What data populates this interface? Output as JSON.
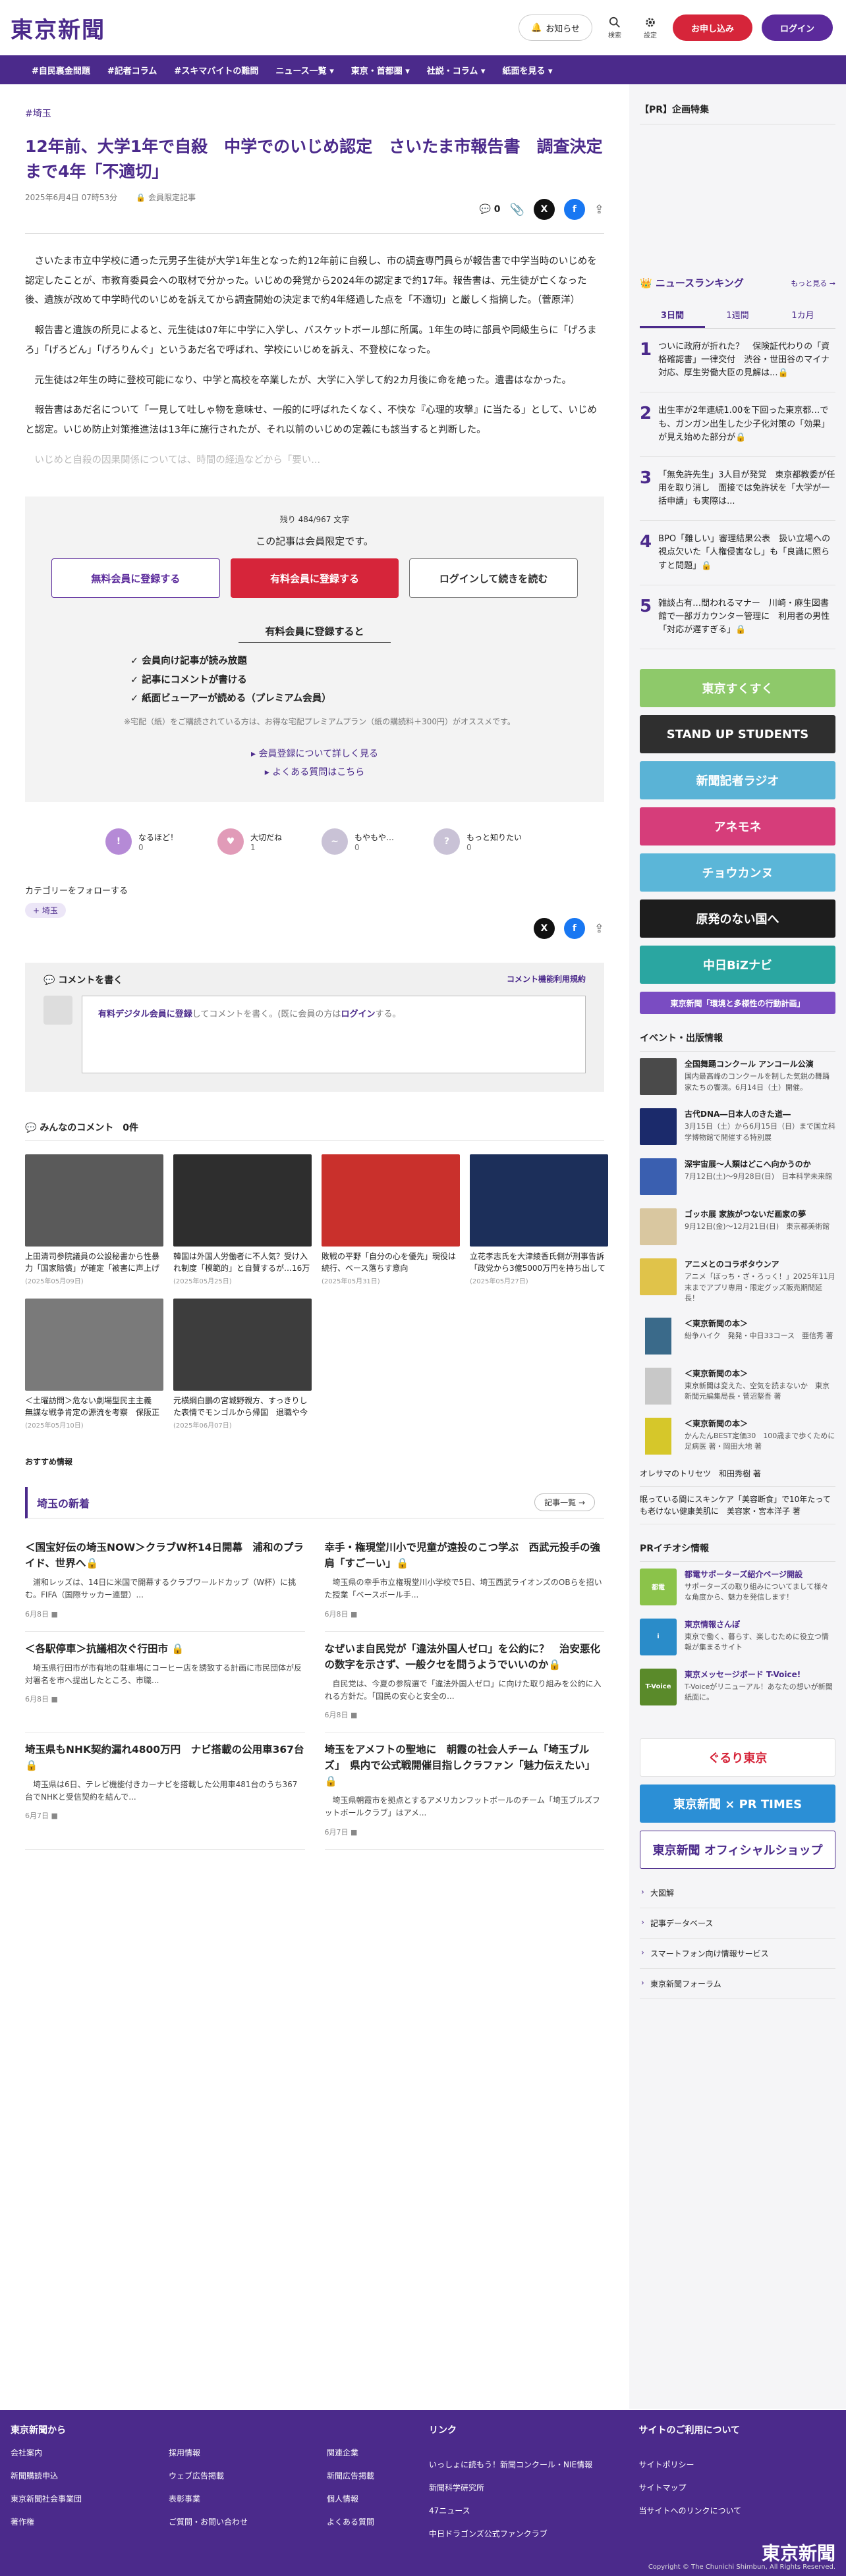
{
  "header": {
    "logo": "東京新聞",
    "notify": "お知らせ",
    "search": "検索",
    "settings": "設定",
    "subscribe": "お申し込み",
    "login": "ログイン"
  },
  "nav": [
    "#自民裏金問題",
    "#記者コラム",
    "#スキマバイトの難問",
    "ニュース一覧 ▾",
    "東京・首都圏 ▾",
    "社説・コラム ▾",
    "紙面を見る ▾"
  ],
  "article": {
    "tag": "#埼玉",
    "title": "12年前、大学1年で自殺　中学でのいじめ認定　さいたま市報告書　調査決定まで4年「不適切」",
    "date": "2025年6月4日 07時53分",
    "member_only": "会員限定記事",
    "comment_count": "0",
    "paragraphs": [
      "　さいたま市立中学校に通った元男子生徒が大学1年生となった約12年前に自殺し、市の調査専門員らが報告書で中学当時のいじめを認定したことが、市教育委員会への取材で分かった。いじめの発覚から2024年の認定まで約17年。報告書は、元生徒が亡くなった後、遺族が改めて中学時代のいじめを訴えてから調査開始の決定まで約4年経過した点を「不適切」と厳しく指摘した。（菅原洋）",
      "　報告書と遺族の所見によると、元生徒は07年に中学に入学し、バスケットボール部に所属。1年生の時に部員や同級生らに「げろまろ」「げろどん」「げろりんぐ」というあだ名で呼ばれ、学校にいじめを訴え、不登校になった。",
      "　元生徒は2年生の時に登校可能になり、中学と高校を卒業したが、大学に入学して約2カ月後に命を絶った。遺書はなかった。",
      "　報告書はあだ名について「一見して吐しゃ物を意味せ、一般的に呼ばれたくなく、不快な『心理的攻撃』に当たる」として、いじめと認定。いじめ防止対策推進法は13年に施行されたが、それ以前のいじめの定義にも該当すると判断した。"
    ],
    "fade_paragraph": "　いじめと自殺の因果関係については、時間の経過などから「要い...",
    "share": {
      "x": "X",
      "facebook": "f"
    }
  },
  "paywall": {
    "remaining": "残り 484/967 文字",
    "members_only": "この記事は会員限定です。",
    "free_btn": "無料会員に登録する",
    "paid_btn": "有料会員に登録する",
    "login_btn": "ログインして続きを読む",
    "benefit_title": "有料会員に登録すると",
    "benefits": [
      "✓ 会員向け記事が読み放題",
      "✓ 記事にコメントが書ける",
      "✓ 紙面ビューアーが読める（プレミアム会員）"
    ],
    "notice": "※宅配（紙）をご購読されている方は、お得な宅配プレミアムプラン（紙の購読料＋300円）がオススメです。",
    "link1": "▸ 会員登録について詳しく見る",
    "link2": "▸ よくある質問はこちら"
  },
  "reactions": [
    {
      "label": "なるほど！",
      "count": "0",
      "color": "#b58ad6",
      "glyph": "!"
    },
    {
      "label": "大切だね",
      "count": "1",
      "color": "#e19bb8",
      "glyph": "♥"
    },
    {
      "label": "もやもや…",
      "count": "0",
      "color": "#c9c2d6",
      "glyph": "~"
    },
    {
      "label": "もっと知りたい",
      "count": "0",
      "color": "#c9c2d6",
      "glyph": "?"
    }
  ],
  "follow": {
    "title": "カテゴリーをフォローする",
    "chip": "埼玉"
  },
  "comments": {
    "write": "コメントを書く",
    "policy": "コメント機能利用規約",
    "placeholder_a": "有料デジタル会員に登録",
    "placeholder_b": "してコメントを書く。(既に会員の方は",
    "placeholder_c": "ログイン",
    "placeholder_d": "する。",
    "all": "みんなのコメント　0件"
  },
  "thumbs": [
    {
      "title": "上田清司参院議員の公設秘書から性暴力「国家賠償」が確定「被害に声上げることため...",
      "date": "(2025年05月09日)",
      "color": "#5a5a5a"
    },
    {
      "title": "韓国は外国人労働者に不人気？受け入れ制度「模範的」と自賛するが…16万5000人の枠が半...",
      "date": "(2025年05月25日)",
      "color": "#2e2e2e"
    },
    {
      "title": "敗戦の平野「自分の心を優先」現役は続行、ベース落ちす意向",
      "date": "(2025年05月31日)",
      "color": "#c9302c"
    },
    {
      "title": "立花孝志氏を大津綾香氏側が刑事告訴「政党から3億5000万円を持ち出して一部を横領」警...",
      "date": "(2025年05月27日)",
      "color": "#1c2f5a"
    },
    {
      "title": "＜土曜訪問＞危ない劇場型民主主義　無謀な戦争肯定の源流を考察　保阪正康さん（ノンフィ...",
      "date": "(2025年05月10日)",
      "color": "#7a7a7a"
    },
    {
      "title": "元横綱白鵬の宮城野親方、すっきりした表情でモンゴルから帰国　退職や今後については言...",
      "date": "(2025年06月07日)",
      "color": "#3d3d3d"
    }
  ],
  "recommend": "おすすめ情報",
  "saitama": {
    "title": "埼玉の新着",
    "more": "記事一覧 →",
    "items": [
      {
        "title": "＜国宝好伝の埼玉NOW＞クラブW杯14日開幕　浦和のプライド、世界へ🔒",
        "body": "　浦和レッズは、14日に米国で開幕するクラブワールドカップ（W杯）に挑む。FIFA（国際サッカー連盟）...",
        "date": "6月8日 ■"
      },
      {
        "title": "幸手・権現堂川小で児童が遠投のこつ学ぶ　西武元投手の強肩「すごーい」🔒",
        "body": "　埼玉県の幸手市立権現堂川小学校で5日、埼玉西武ライオンズのOBらを招いた授業「ベースボール手...",
        "date": "6月8日 ■"
      },
      {
        "title": "＜各駅停車＞抗議相次ぐ行田市 🔒",
        "body": "　埼玉県行田市が市有地の駐車場にコーヒー店を誘致する計画に市民団体が反対署名を市へ提出したところ、市職...",
        "date": "6月8日 ■"
      },
      {
        "title": "なぜいま自民党が「違法外国人ゼロ」を公約に？　治安悪化の数字を示さず、一般クセを問うようでいいのか🔒",
        "body": "　自民党は、今夏の参院選で「違法外国人ゼロ」に向けた取り組みを公約に入れる方針だ。「国民の安心と安全の...",
        "date": "6月8日 ■"
      },
      {
        "title": "埼玉県もNHK契約漏れ4800万円　ナビ搭載の公用車367台 🔒",
        "body": "　埼玉県は6日、テレビ機能付きカーナビを搭載した公用車481台のうち367台でNHKと受信契約を結んで...",
        "date": "6月7日 ■"
      },
      {
        "title": "埼玉をアメフトの聖地に　朝霞の社会人チーム「埼玉ブルズ」　県内で公式戦開催目指しクラファン「魅力伝えたい」🔒",
        "body": "　埼玉県朝霞市を拠点とするアメリカンフットボールのチーム「埼玉ブルズフットボールクラブ」はアメ...",
        "date": "6月7日 ■"
      }
    ]
  },
  "sidebar": {
    "pr_title": "【PR】企画特集",
    "ranking_title": "ニュースランキング",
    "ranking_more": "もっと見る →",
    "tabs": [
      "3日間",
      "1週間",
      "1カ月"
    ],
    "ranking": [
      "ついに政府が折れた？　保険証代わりの「資格確認書」一律交付　渋谷・世田谷のマイナ対応、厚生労働大臣の見解は...🔒",
      "出生率が2年連続1.00を下回った東京都…でも、ガンガン出生した少子化対策の「効果」が見え始めた部分が🔒",
      "「無免許先生」3人目が発覚　東京都教委が任用を取り消し　面接では免許状を「大学が一括申請」も実際は...",
      "BPO「難しい」審理結果公表　扱い立場への視点欠いた「人権侵害なし」も「良識に照らすと問題」🔒",
      "雑談占有…間われるマナー　川崎・麻生図書館で一部ガカウンター管理に　利用者の男性「対応が遅すぎる」🔒"
    ],
    "banners": [
      {
        "text": "東京すくすく",
        "color": "#8ec96a"
      },
      {
        "text": "STAND UP STUDENTS",
        "color": "#2f2f2f"
      },
      {
        "text": "新聞記者ラジオ",
        "color": "#5ab3d6"
      },
      {
        "text": "アネモネ",
        "color": "#d63d7a"
      },
      {
        "text": "チョウカンヌ",
        "color": "#5bb6d8"
      },
      {
        "text": "原発のない国へ",
        "color": "#1d1d1d"
      },
      {
        "text": "中日BiZナビ",
        "color": "#2aa6a1"
      },
      {
        "text": "東京新聞「環境と多様性の行動計画」",
        "color": "#7a4cc2"
      }
    ],
    "events_title": "イベント・出版情報",
    "events": [
      {
        "title": "全国舞踊コンクール アンコール公演",
        "desc": "国内最高峰のコンクールを制した気鋭の舞踊家たちの饗演。6月14日（土）開催。",
        "color": "#4a4a4a"
      },
      {
        "title": "古代DNA―日本人のきた道―",
        "desc": "3月15日（土）から6月15日（日）まで国立科学博物館で開催する特別展",
        "color": "#1b2a6b"
      },
      {
        "title": "深宇宙展～人類はどこへ向かうのか",
        "desc": "7月12日(土)～9月28日(日)　日本科学未来館",
        "color": "#3a5fb0"
      },
      {
        "title": "ゴッホ展 家族がつないだ画家の夢",
        "desc": "9月12日(金)～12月21日(日)　東京都美術館",
        "color": "#d9c7a0"
      },
      {
        "title": "アニメとのコラボタウンア",
        "desc": "アニメ「ぼっち・ざ・ろっく！」2025年11月末までアプリ専用・限定グッズ販売期間延長！",
        "color": "#e0c34a"
      }
    ],
    "books": [
      {
        "title": "＜東京新聞の本＞",
        "desc": "紛争ハイク　発発・中日33コース　亜信秀 著",
        "color": "#3a6a8a"
      },
      {
        "title": "＜東京新聞の本＞",
        "desc": "東京新聞は変えた、空気を読まないか　東京新聞元編集局長・菅沼堅吾 著",
        "color": "#c8c8c8"
      },
      {
        "title": "＜東京新聞の本＞",
        "desc": "かんたんBEST定価30　100歳まで歩くために　足病医 著・岡田大地 著",
        "color": "#d6c72a"
      }
    ],
    "links": [
      "オレサマのトリセツ　和田秀樹 著",
      "眠っている間にスキンケア「美容断食」で10年たっても老けない健康美肌に　美容家・宮本洋子 著"
    ],
    "pr2_title": "PRイチオシ情報",
    "pr2": [
      {
        "title": "都電サポーターズ紹介ページ開設",
        "desc": "サポーターズの取り組みについてまして様々な角度から、魅力を発信します！",
        "color": "#8bc34a",
        "img": "都電"
      },
      {
        "title": "東京情報さんぽ",
        "desc": "東京で働く、暮らす、楽しむために役立つ情報が集まるサイト",
        "color": "#2a8cc9",
        "img": "i"
      },
      {
        "title": "東京メッセージボード T-Voice!",
        "desc": "T-Voiceがリニューアル！あなたの想いが新聞紙面に。",
        "color": "#5a8a2a",
        "img": "T-Voice"
      }
    ],
    "promo_banners": [
      {
        "text": "ぐるり東京",
        "color": "#fff",
        "fg": "#d6253a"
      },
      {
        "text": "東京新聞 × PR TIMES",
        "color": "#2b8fd6",
        "fg": "#fff"
      },
      {
        "text": "東京新聞 オフィシャルショップ",
        "color": "#fff",
        "fg": "#4b2a8b"
      }
    ],
    "services": [
      "大図解",
      "記事データベース",
      "スマートフォン向け情報サービス",
      "東京新聞フォーラム"
    ]
  },
  "footer": {
    "col1_title": "東京新聞から",
    "col1": [
      "会社案内",
      "採用情報",
      "関連企業",
      "新聞購読申込",
      "ウェブ広告掲載",
      "新聞広告掲載",
      "東京新聞社会事業団",
      "表彰事業",
      "個人情報",
      "著作権",
      "ご質問・お問い合わせ",
      "よくある質問"
    ],
    "col2_title": "リンク",
    "col2": [
      "いっしょに読もう！新聞コンクール・NIE情報",
      "新聞科学研究所",
      "47ニュース",
      "中日ドラゴンズ公式ファンクラブ"
    ],
    "col3_title": "サイトのご利用について",
    "col3": [
      "サイトポリシー",
      "サイトマップ",
      "当サイトへのリンクについて"
    ],
    "logo": "東京新聞",
    "copyright": "Copyright © The Chunichi Shimbun, All Rights Reserved."
  }
}
